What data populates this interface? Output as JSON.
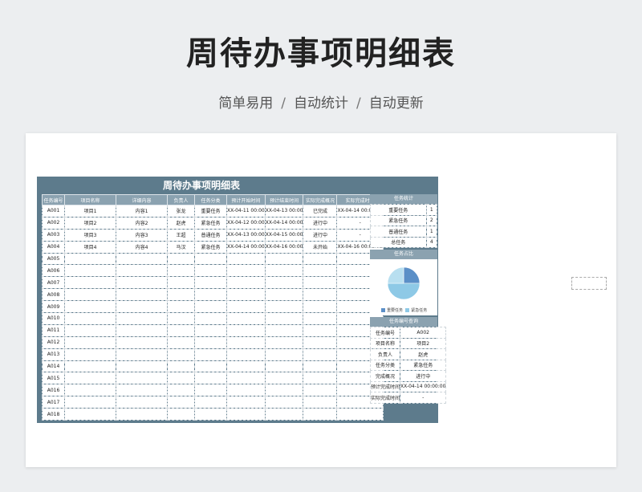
{
  "page": {
    "title": "周待办事项明细表",
    "subtitle_parts": [
      "简单易用",
      "自动统计",
      "自动更新"
    ],
    "separator": "/"
  },
  "sheet": {
    "title": "周待办事项明细表",
    "headers": [
      "任务编号",
      "项目名称",
      "详细内容",
      "负责人",
      "任务分类",
      "预计开始时间",
      "预计结束时间",
      "实际完成概况",
      "实际完成时间"
    ],
    "rows": [
      [
        "A001",
        "项目1",
        "内容1",
        "张龙",
        "重要任务",
        "XX-04-11 00:00",
        "XX-04-13 00:00",
        "已完成",
        "XX-04-14 00:00:00"
      ],
      [
        "A002",
        "项目2",
        "内容2",
        "赵虎",
        "紧急任务",
        "XX-04-12 00:00",
        "XX-04-14 00:00",
        "进行中",
        "-"
      ],
      [
        "A003",
        "项目3",
        "内容3",
        "王超",
        "普通任务",
        "XX-04-13 00:00",
        "XX-04-15 00:00",
        "进行中",
        "-"
      ],
      [
        "A004",
        "项目4",
        "内容4",
        "马汉",
        "紧急任务",
        "XX-04-14 00:00",
        "XX-04-16 00:00",
        "未开始",
        "XX-04-16 00:00:00"
      ],
      [
        "A005",
        "",
        "",
        "",
        "",
        "",
        "",
        "",
        ""
      ],
      [
        "A006",
        "",
        "",
        "",
        "",
        "",
        "",
        "",
        ""
      ],
      [
        "A007",
        "",
        "",
        "",
        "",
        "",
        "",
        "",
        ""
      ],
      [
        "A008",
        "",
        "",
        "",
        "",
        "",
        "",
        "",
        ""
      ],
      [
        "A009",
        "",
        "",
        "",
        "",
        "",
        "",
        "",
        ""
      ],
      [
        "A010",
        "",
        "",
        "",
        "",
        "",
        "",
        "",
        ""
      ],
      [
        "A011",
        "",
        "",
        "",
        "",
        "",
        "",
        "",
        ""
      ],
      [
        "A012",
        "",
        "",
        "",
        "",
        "",
        "",
        "",
        ""
      ],
      [
        "A013",
        "",
        "",
        "",
        "",
        "",
        "",
        "",
        ""
      ],
      [
        "A014",
        "",
        "",
        "",
        "",
        "",
        "",
        "",
        ""
      ],
      [
        "A015",
        "",
        "",
        "",
        "",
        "",
        "",
        "",
        ""
      ],
      [
        "A016",
        "",
        "",
        "",
        "",
        "",
        "",
        "",
        ""
      ],
      [
        "A017",
        "",
        "",
        "",
        "",
        "",
        "",
        "",
        ""
      ],
      [
        "A018",
        "",
        "",
        "",
        "",
        "",
        "",
        "",
        ""
      ]
    ]
  },
  "stats": {
    "heading": "任务统计",
    "rows": [
      [
        "重要任务",
        "1"
      ],
      [
        "紧急任务",
        "2"
      ],
      [
        "普通任务",
        "1"
      ],
      [
        "总任务",
        "4"
      ]
    ]
  },
  "pie": {
    "heading": "任务占比",
    "slices": [
      {
        "name": "重要任务",
        "value": 1,
        "color": "#5b8fc7"
      },
      {
        "name": "紧急任务",
        "value": 2,
        "color": "#8ec9e6"
      },
      {
        "name": "普通任务",
        "value": 1,
        "color": "#b8dff0"
      }
    ],
    "legend": [
      "重要任务",
      "紧急任务"
    ]
  },
  "query": {
    "heading": "任务编号查询",
    "rows": [
      [
        "任务编号",
        "A002"
      ],
      [
        "项目名称",
        "项目2"
      ],
      [
        "负责人",
        "赵虎"
      ],
      [
        "任务分类",
        "紧急任务"
      ],
      [
        "完成概况",
        "进行中"
      ],
      [
        "预计完成时间",
        "XX-04-14 00:00:00"
      ],
      [
        "实际完成时间",
        "-"
      ]
    ]
  },
  "colors": {
    "sheet_bg": "#5d7b8c",
    "header_bg": "#8ba2b0"
  }
}
